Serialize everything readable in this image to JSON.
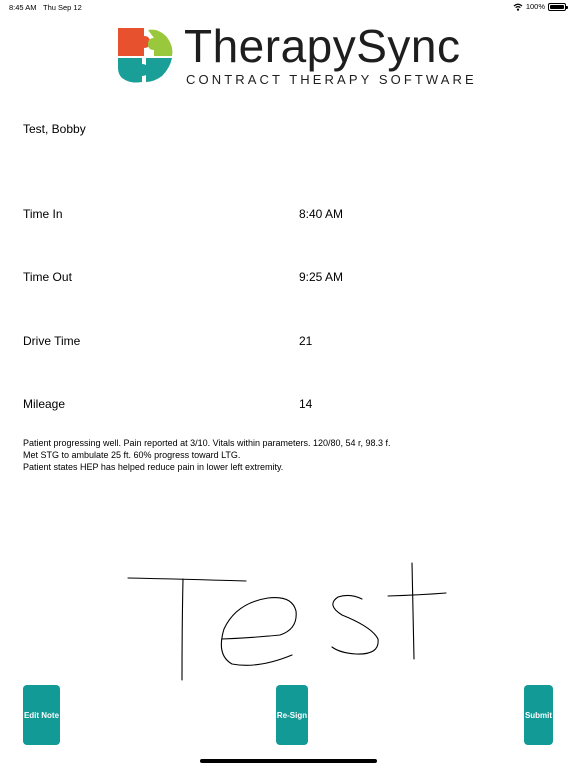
{
  "status_bar": {
    "time": "8:45 AM",
    "date": "Thu Sep 12",
    "battery": "100%"
  },
  "logo": {
    "name": "TherapySync",
    "tagline": "CONTRACT THERAPY SOFTWARE"
  },
  "patient": {
    "name": "Test, Bobby"
  },
  "fields": [
    {
      "label": "Time In",
      "value": "8:40 AM"
    },
    {
      "label": "Time Out",
      "value": "9:25 AM"
    },
    {
      "label": "Drive Time",
      "value": "21"
    },
    {
      "label": "Mileage",
      "value": "14"
    }
  ],
  "note": {
    "lines": [
      "Patient progressing well. Pain reported at 3/10. Vitals within parameters. 120/80, 54 r, 98.3 f.",
      "Met STG to ambulate 25 ft. 60% progress toward LTG.",
      "Patient states HEP has helped reduce pain in lower left extremity."
    ]
  },
  "signature": {
    "text": "Test"
  },
  "buttons": {
    "edit": "Edit Note",
    "resign": "Re-Sign",
    "submit": "Submit"
  },
  "colors": {
    "accent": "#129a96",
    "logo_orange": "#e8512e",
    "logo_green": "#9ac83c",
    "logo_teal": "#1a9e98"
  }
}
